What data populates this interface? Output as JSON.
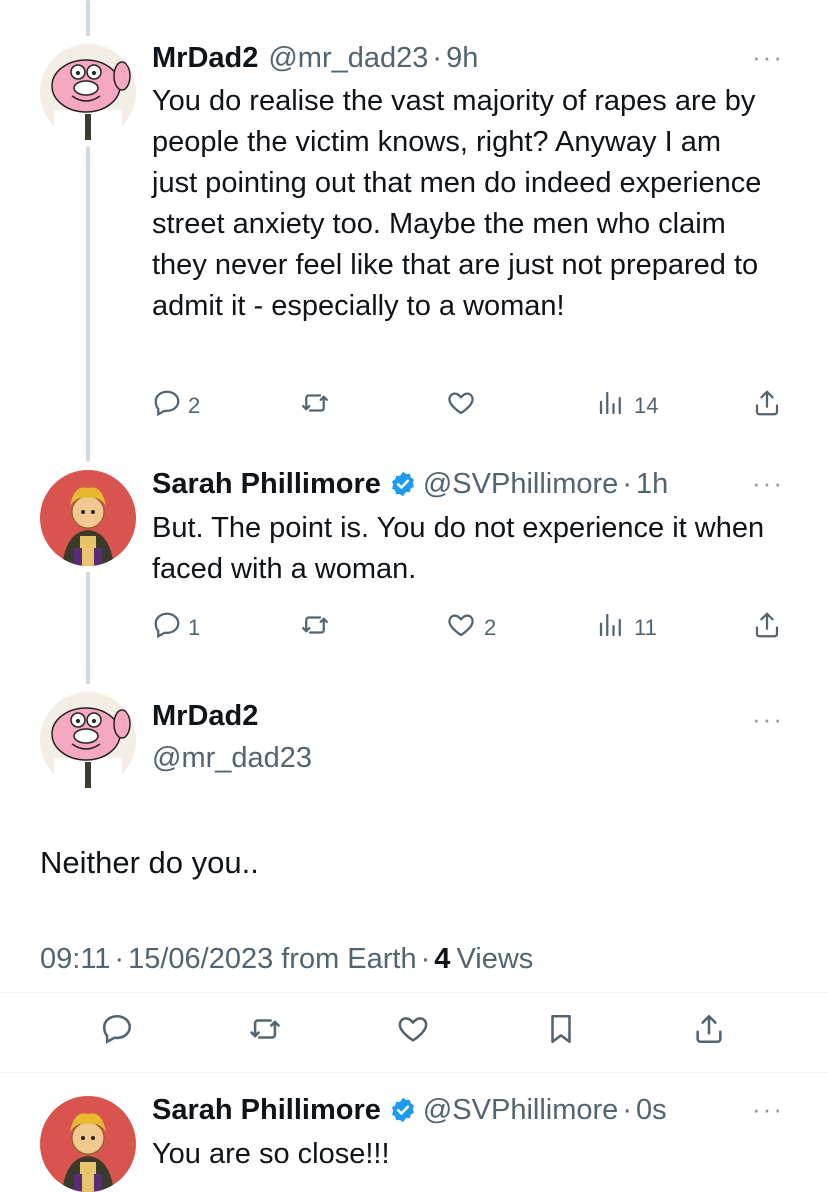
{
  "tweets": [
    {
      "name": "MrDad2",
      "handle": "@mr_dad23",
      "time": "9h",
      "text": "You do realise the vast majority of rapes are by people the victim knows, right? Anyway I am just pointing out that men do indeed experience street anxiety too. Maybe the men who claim they never feel like that are just not prepared to admit it - especially to a woman!",
      "replies": "2",
      "retweets": "",
      "likes": "",
      "views": "14"
    },
    {
      "name": "Sarah Phillimore",
      "handle": "@SVPhillimore",
      "time": "1h",
      "text": "But. The point is. You do not experience it when faced with a woman.",
      "replies": "1",
      "retweets": "",
      "likes": "2",
      "views": "11"
    }
  ],
  "focused": {
    "name": "MrDad2",
    "handle": "@mr_dad23",
    "text": "Neither do you..",
    "time": "09:11",
    "date": "15/06/2023",
    "source": "from Earth",
    "views_count": "4",
    "views_label": "Views"
  },
  "reply": {
    "name": "Sarah Phillimore",
    "handle": "@SVPhillimore",
    "time": "0s",
    "text": "You are so close!!!"
  },
  "ui": {
    "dot": "·",
    "more": "···"
  },
  "colors": {
    "verified": "#1d9bf0",
    "muted": "#536471",
    "thread_line": "#cfd9de"
  },
  "icons": [
    "reply-icon",
    "retweet-icon",
    "like-icon",
    "views-icon",
    "share-icon",
    "bookmark-icon",
    "verified-badge-icon",
    "more-icon"
  ]
}
